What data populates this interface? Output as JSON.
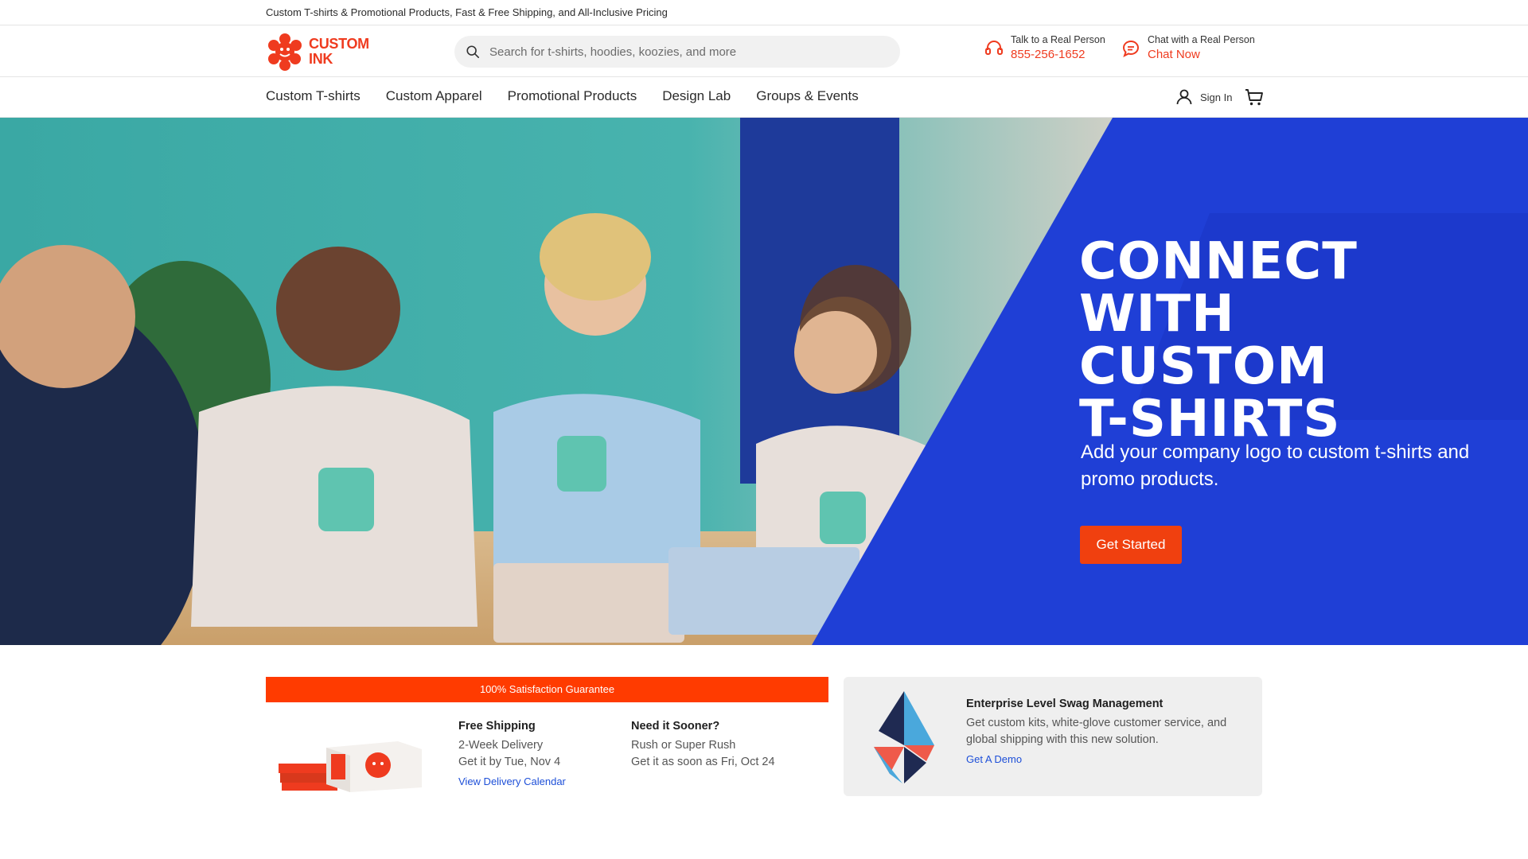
{
  "promo": {
    "text": "Custom T-shirts & Promotional Products, Fast & Free Shipping, and All-Inclusive Pricing"
  },
  "header": {
    "logo_text_line1": "CUSTOM",
    "logo_text_line2": "INK",
    "search_placeholder": "Search for t-shirts, hoodies, koozies, and more",
    "phone_label": "Talk to a Real Person",
    "phone_number": "855-256-1652",
    "chat_label": "Chat with a Real Person",
    "chat_link": "Chat Now"
  },
  "nav": {
    "items": [
      "Custom T-shirts",
      "Custom Apparel",
      "Promotional Products",
      "Design Lab",
      "Groups & Events"
    ],
    "signin_label": "Sign In"
  },
  "hero": {
    "title_line1": "CONNECT WITH",
    "title_line2": "CUSTOM",
    "title_line3": "T-SHIRTS",
    "subtitle": "Add your company logo to custom t-shirts and promo products.",
    "cta_label": "Get Started",
    "brand_blue": "#1f3fd6"
  },
  "info": {
    "guarantee": "100% Satisfaction Guarantee",
    "free_shipping": {
      "title": "Free Shipping",
      "line1": "2-Week Delivery",
      "line2": "Get it by Tue, Nov 4",
      "link": "View Delivery Calendar"
    },
    "need_sooner": {
      "title": "Need it Sooner?",
      "line1": "Rush or Super Rush",
      "line2": "Get it as soon as Fri, Oct 24"
    },
    "enterprise": {
      "title": "Enterprise Level Swag Management",
      "text": "Get custom kits, white-glove customer service, and global shipping with this new solution.",
      "link": "Get A Demo"
    }
  },
  "colors": {
    "accent_orange": "#ef3b1f",
    "cta_orange": "#f0400f",
    "link_blue": "#1d4fd8"
  },
  "icons": [
    "search-icon",
    "headset-icon",
    "chat-icon",
    "user-icon",
    "cart-icon"
  ]
}
